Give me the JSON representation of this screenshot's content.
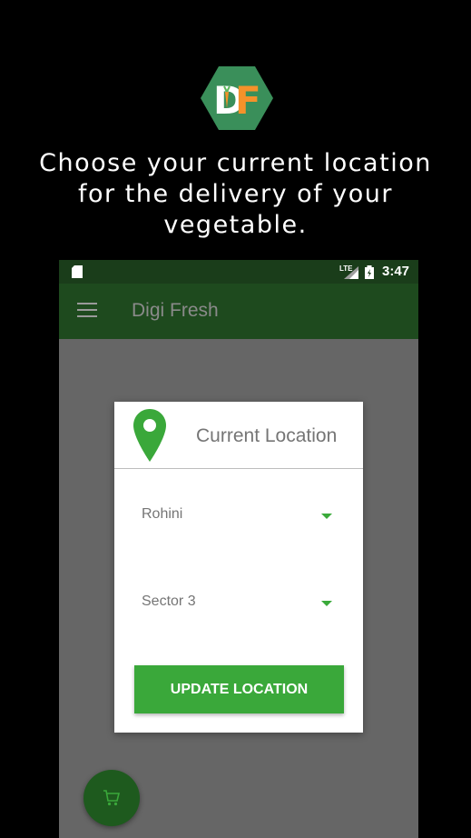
{
  "brand": {
    "logo_text": "DF",
    "hex_color": "#3a8f5a",
    "accent": "#f5922a"
  },
  "headline": {
    "line1": "Choose your current location",
    "line2": "for the delivery of your",
    "line3": "vegetable."
  },
  "statusbar": {
    "network": "LTE",
    "time": "3:47"
  },
  "appbar": {
    "title": "Digi Fresh",
    "menu_icon": "hamburger-icon"
  },
  "dialog": {
    "title": "Current Location",
    "icon": "location-pin-icon",
    "area_select": {
      "value": "Rohini"
    },
    "sector_select": {
      "value": "Sector 3"
    },
    "button_label": "UPDATE LOCATION"
  },
  "fab": {
    "icon": "shopping-cart-icon"
  },
  "colors": {
    "status_bar": "#1a3d1a",
    "app_bar": "#1e4a1e",
    "primary_green": "#3aa83a",
    "overlay": "#666666"
  }
}
